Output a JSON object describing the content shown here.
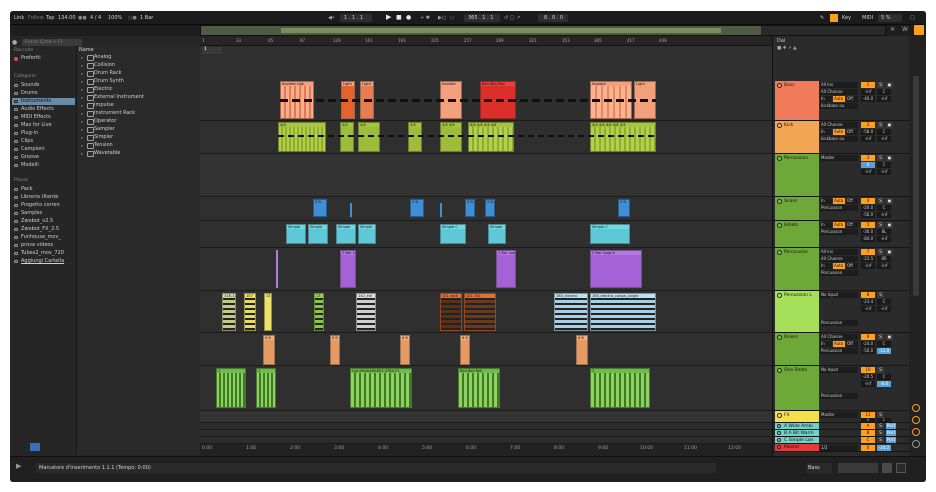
{
  "transport": {
    "link": "Link",
    "follow": "Follow",
    "tap": "Tap",
    "tempo": "134.00",
    "signature": "4 / 4",
    "zoom": "100%",
    "quantize": "1 Bar",
    "position": "1 . 1 . 1",
    "loop_start": "365 . 1 . 1",
    "loop_length": "8 . 0 . 0",
    "key": "Key",
    "midi": "MIDI",
    "cpu": "5 %"
  },
  "browser": {
    "search_placeholder": "Cerca (Cmd + F)",
    "collections_header": "Raccolte",
    "favorites": "Preferiti",
    "categories_header": "Categorie",
    "categories": [
      "Sounds",
      "Drums",
      "Instruments",
      "Audio Effects",
      "MIDI Effects",
      "Max for Live",
      "Plug-in",
      "Clips",
      "Campioni",
      "Groove",
      "Modelli"
    ],
    "selected_category": "Instruments",
    "places_header": "Places",
    "places": [
      "Pack",
      "Libreria Utente",
      "Progetto corren",
      "Samples",
      "Zwobot_v2.5",
      "Zwobot_FX_2.5",
      "Funhouse_mov_",
      "prove videos",
      "Tubes2_mov_720",
      "Aggiungi Cartella"
    ],
    "name_header": "Name",
    "items": [
      "Analog",
      "Collision",
      "Drum Rack",
      "Drum Synth",
      "Electric",
      "External Instrument",
      "Impulse",
      "Instrument Rack",
      "Operator",
      "Sampler",
      "Simpler",
      "Tension",
      "Wavetable"
    ]
  },
  "arrangement": {
    "ruler_marks": [
      "1",
      "33",
      "65",
      "97",
      "129",
      "161",
      "193",
      "225",
      "257",
      "289",
      "321",
      "353",
      "385",
      "417",
      "449"
    ],
    "time_marks": [
      "0:00",
      "1:00",
      "2:00",
      "3:00",
      "4:00",
      "5:00",
      "6:00",
      "7:00",
      "8:00",
      "9:00",
      "10:00",
      "11:00",
      "12:00"
    ],
    "loop_marker": "1",
    "clip_labels": {
      "impiet": "Impiete Ligh",
      "ligh": "Light",
      "impiete2": "Impiete",
      "ben": "Ben Ben Ben",
      "impiete3": "Impiete",
      "light2": "Light",
      "k1": "4/4",
      "k2": "4/4",
      "k3": "4/4 4/4",
      "k4": "4/4 4/4 4/4 4/4",
      "k5": "4/4 4/4 4/4 4/4 4/4",
      "simple": "Simple",
      "simple_c": "Simple C",
      "bar_loop": "2 Bar Loop",
      "bar_loop2": "2 Bar Loop",
      "bar_loop3": "2 Bar Loop.b",
      "electro": "142_ele",
      "rock": "141 rock",
      "electro2": "141 141",
      "conga1": "160_electro",
      "conga2": "160_electro_conga_jungle",
      "one": "Cgf 6M4AAKKKE3 XTRA F1",
      "one2": "Bell Bell Bell",
      "b1": "118_1",
      "b2": "157",
      "b3": "13",
      "b4": "6 B",
      "b5": "6 B",
      "b6": "6 B",
      "b7": "6 B",
      "b8": "6 B"
    }
  },
  "mixer": {
    "header_label": "Dai",
    "tracks": [
      {
        "name": "Bass",
        "color": "#f07b5b",
        "input": "All Ins",
        "sub": "All Channe",
        "sub2": "kickbass ou",
        "mon_in": "In",
        "mon_auto": "Auto",
        "mon_off": "Off",
        "num": "1",
        "vol": "-inf",
        "pan": "C",
        "send1": "-40.0",
        "send2": "-inf"
      },
      {
        "name": "Kick",
        "color": "#f2a552",
        "input": "All Channe",
        "sub": "kickbass ou",
        "mon_in": "In",
        "mon_auto": "Auto",
        "mon_off": "Off",
        "num": "2",
        "vol": "-58.0",
        "pan": "C",
        "send1": "-inf",
        "send2": "-inf"
      },
      {
        "name": "Percussion",
        "color": "#8dc63f",
        "input": "Master",
        "num": "3",
        "vol": "0",
        "pan": "C",
        "send1": "-inf",
        "send2": "-inf"
      },
      {
        "name": "Snare",
        "color": "#8dc63f",
        "input": "Percussion",
        "mon_in": "In",
        "mon_auto": "Auto",
        "mon_off": "Off",
        "num": "4",
        "vol": "-20.0",
        "pan": "C",
        "send1": "-56.0",
        "send2": "-inf"
      },
      {
        "name": "Hihats",
        "color": "#8dc63f",
        "input": "Percussion",
        "mon_in": "In",
        "mon_auto": "Auto",
        "mon_off": "Off",
        "num": "5",
        "vol": "-30.0",
        "pan": "8L",
        "send1": "-84.0",
        "send2": "-inf"
      },
      {
        "name": "Percussion",
        "color": "#8dc63f",
        "input": "All Ins",
        "sub": "All Channe",
        "sub2": "Percussion",
        "mon_in": "In",
        "mon_auto": "Auto",
        "mon_off": "Off",
        "num": "7",
        "vol": "-23.5",
        "pan": "8R",
        "send1": "-inf",
        "send2": "-inf"
      },
      {
        "name": "Percussion L",
        "color": "#a6e05a",
        "input": "No Input",
        "sub2": "Percussion",
        "num": "8",
        "vol": "-23.4",
        "pan": "C",
        "send1": "-inf",
        "send2": "-inf"
      },
      {
        "name": "Risers",
        "color": "#8dc63f",
        "input": "All Channe",
        "sub": "Percussion",
        "mon_in": "In",
        "mon_auto": "Auto",
        "mon_off": "Off",
        "num": "9",
        "vol": "-24.0",
        "pan": "C",
        "send1": "-50.0",
        "send2": "-12.0"
      },
      {
        "name": "One Shots",
        "color": "#8dc63f",
        "input": "No Input",
        "sub2": "Percussion",
        "num": "10",
        "vol": "-20.5",
        "pan": "C",
        "send1": "-inf",
        "send2": "-8.8"
      },
      {
        "name": "FX",
        "color": "#f4e04d",
        "input": "Master",
        "num": "11",
        "vol": "0",
        "pan": "C",
        "send1": "-inf",
        "send2": "-inf"
      },
      {
        "name": "A Wide Ambi",
        "color": "#6fd1c8",
        "num": "A",
        "send1": "S",
        "send2": "Post"
      },
      {
        "name": "B A Bit Warm",
        "color": "#6fd1c8",
        "num": "B",
        "send1": "S",
        "send2": "Post"
      },
      {
        "name": "C Simple Lon",
        "color": "#6fd1c8",
        "num": "C",
        "send1": "S",
        "send2": "Post"
      },
      {
        "name": "Master",
        "color": "#e23b3b",
        "input": "1/2",
        "num": "0",
        "vol": "-24.2"
      }
    ]
  },
  "status": {
    "text": "Marcatore d'inserimento 1.1.1 (Tempo: 0:00)",
    "right_label": "Bass"
  }
}
